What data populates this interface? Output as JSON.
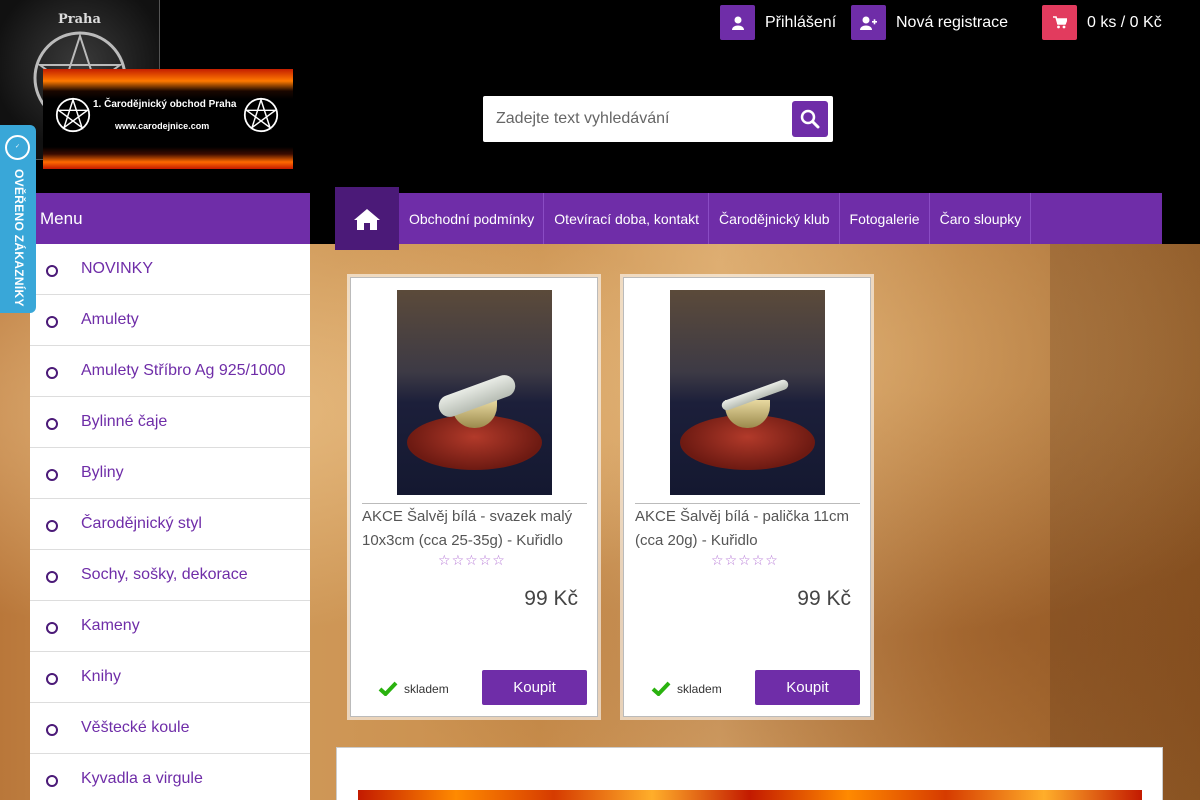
{
  "header": {
    "logo_text": "Praha",
    "logo_side_text": "1. Čaroděj",
    "banner_title": "1. Čarodějnický obchod Praha",
    "banner_url": "www.carodejnice.com",
    "login_label": "Přihlášení",
    "register_label": "Nová registrace",
    "cart_label": "0 ks / 0 Kč",
    "verified_badge": "OVĚŘENO ZÁKAZNÍKY",
    "verified_seal": "ověřeno zákazníky"
  },
  "search": {
    "placeholder": "Zadejte text vyhledávání"
  },
  "nav": {
    "items": [
      "Obchodní podmínky",
      "Otevírací doba, kontakt",
      "Čarodějnický klub",
      "Fotogalerie",
      "Čaro sloupky"
    ]
  },
  "sidebar": {
    "heading": "Menu",
    "items": [
      "NOVINKY",
      "Amulety",
      "Amulety Stříbro Ag 925/1000",
      "Bylinné čaje",
      "Byliny",
      "Čarodějnický styl",
      "Sochy, sošky, dekorace",
      "Kameny",
      "Knihy",
      "Věštecké koule",
      "Kyvadla a virgule"
    ]
  },
  "products": [
    {
      "title": "AKCE Šalvěj bílá - svazek malý 10x3cm (cca 25-35g) - Kuřidlo",
      "price": "99 Kč",
      "rating": 0,
      "stock": "skladem",
      "buy_label": "Koupit"
    },
    {
      "title": "AKCE Šalvěj bílá - palička 11cm (cca 20g) - Kuřidlo",
      "price": "99 Kč",
      "rating": 0,
      "stock": "skladem",
      "buy_label": "Koupit"
    }
  ],
  "colors": {
    "accent": "#6f2da8",
    "accent_dark": "#4b1a78",
    "cart": "#e23b5e",
    "verified": "#39a7d8",
    "stock_ok": "#2ab20f"
  }
}
